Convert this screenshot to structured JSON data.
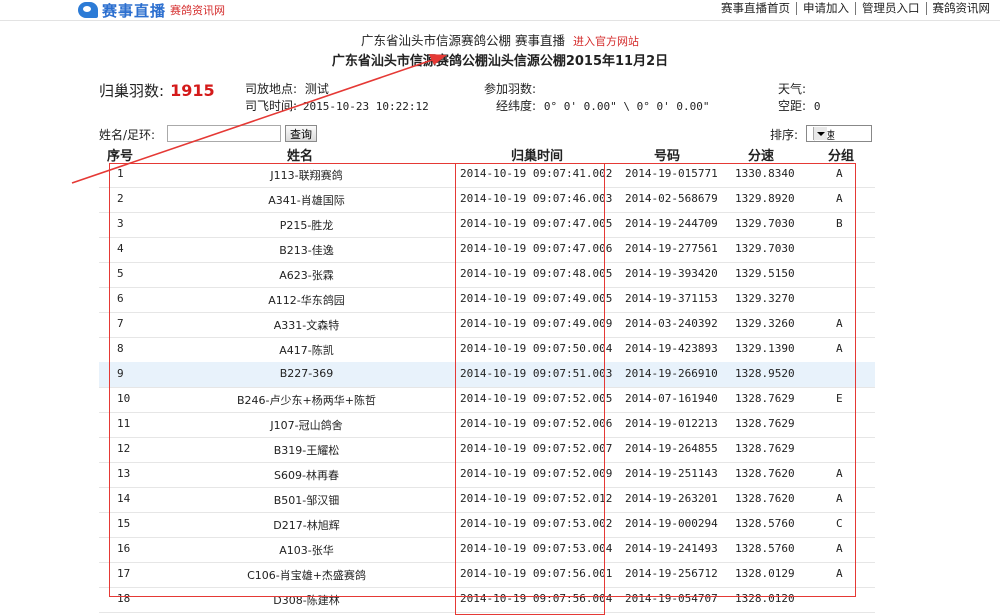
{
  "header": {
    "logo_main": "赛事直播",
    "logo_sub": "赛鸽资讯网",
    "nav": [
      "赛事直播首页",
      "申请加入",
      "管理员入口",
      "赛鸽资讯网"
    ]
  },
  "subtitle": {
    "loft": "广东省汕头市信源赛鸽公棚",
    "live": "赛事直播",
    "official_link": "进入官方网站"
  },
  "race_title": "广东省汕头市信源赛鸽公棚汕头信源公棚2015年11月2日",
  "info": {
    "returned_label": "归巢羽数:",
    "returned_count": "1915",
    "release_place_label": "司放地点:",
    "release_place": "测试",
    "release_time_label": "司飞时间:",
    "release_time": "2015-10-23 10:22:12",
    "entries_label": "参加羽数:",
    "entries": "",
    "coords_label": "经纬度:",
    "coords": "0° 0' 0.00\" \\ 0° 0' 0.00\"",
    "weather_label": "天气:",
    "weather": "",
    "distance_label": "空距:",
    "distance": "0"
  },
  "search": {
    "label": "姓名/足环:",
    "value": "",
    "button": "查询"
  },
  "sort": {
    "label": "排序:",
    "selected": "分速"
  },
  "table": {
    "headers": [
      "序号",
      "姓名",
      "归巢时间",
      "号码",
      "分速",
      "分组"
    ],
    "highlighted_row": 8,
    "rows": [
      {
        "rank": "1",
        "name": "J113-联翔赛鸽",
        "time": "2014-10-19 09:07:41.002",
        "ring": "2014-19-015771",
        "speed": "1330.8340",
        "group": "A"
      },
      {
        "rank": "2",
        "name": "A341-肖雄国际",
        "time": "2014-10-19 09:07:46.003",
        "ring": "2014-02-568679",
        "speed": "1329.8920",
        "group": "A"
      },
      {
        "rank": "3",
        "name": "P215-胜龙",
        "time": "2014-10-19 09:07:47.005",
        "ring": "2014-19-244709",
        "speed": "1329.7030",
        "group": "B"
      },
      {
        "rank": "4",
        "name": "B213-佳逸",
        "time": "2014-10-19 09:07:47.006",
        "ring": "2014-19-277561",
        "speed": "1329.7030",
        "group": ""
      },
      {
        "rank": "5",
        "name": "A623-张霖",
        "time": "2014-10-19 09:07:48.005",
        "ring": "2014-19-393420",
        "speed": "1329.5150",
        "group": ""
      },
      {
        "rank": "6",
        "name": "A112-华东鸽园",
        "time": "2014-10-19 09:07:49.005",
        "ring": "2014-19-371153",
        "speed": "1329.3270",
        "group": ""
      },
      {
        "rank": "7",
        "name": "A331-文森特",
        "time": "2014-10-19 09:07:49.009",
        "ring": "2014-03-240392",
        "speed": "1329.3260",
        "group": "A"
      },
      {
        "rank": "8",
        "name": "A417-陈凯",
        "time": "2014-10-19 09:07:50.004",
        "ring": "2014-19-423893",
        "speed": "1329.1390",
        "group": "A"
      },
      {
        "rank": "9",
        "name": "B227-369",
        "time": "2014-10-19 09:07:51.003",
        "ring": "2014-19-266910",
        "speed": "1328.9520",
        "group": ""
      },
      {
        "rank": "10",
        "name": "B246-卢少东+杨两华+陈哲",
        "time": "2014-10-19 09:07:52.005",
        "ring": "2014-07-161940",
        "speed": "1328.7629",
        "group": "E"
      },
      {
        "rank": "11",
        "name": "J107-冠山鸽舍",
        "time": "2014-10-19 09:07:52.006",
        "ring": "2014-19-012213",
        "speed": "1328.7629",
        "group": ""
      },
      {
        "rank": "12",
        "name": "B319-王耀松",
        "time": "2014-10-19 09:07:52.007",
        "ring": "2014-19-264855",
        "speed": "1328.7629",
        "group": ""
      },
      {
        "rank": "13",
        "name": "S609-林再春",
        "time": "2014-10-19 09:07:52.009",
        "ring": "2014-19-251143",
        "speed": "1328.7620",
        "group": "A"
      },
      {
        "rank": "14",
        "name": "B501-邹汉钿",
        "time": "2014-10-19 09:07:52.012",
        "ring": "2014-19-263201",
        "speed": "1328.7620",
        "group": "A"
      },
      {
        "rank": "15",
        "name": "D217-林旭辉",
        "time": "2014-10-19 09:07:53.002",
        "ring": "2014-19-000294",
        "speed": "1328.5760",
        "group": "C"
      },
      {
        "rank": "16",
        "name": "A103-张华",
        "time": "2014-10-19 09:07:53.004",
        "ring": "2014-19-241493",
        "speed": "1328.5760",
        "group": "A"
      },
      {
        "rank": "17",
        "name": "C106-肖宝雄+杰盛赛鸽",
        "time": "2014-10-19 09:07:56.001",
        "ring": "2014-19-256712",
        "speed": "1328.0129",
        "group": "A"
      },
      {
        "rank": "18",
        "name": "D308-陈建林",
        "time": "2014-10-19 09:07:56.004",
        "ring": "2014-19-054707",
        "speed": "1328.0120",
        "group": ""
      }
    ]
  },
  "annotations": {
    "color": "#e53935"
  }
}
